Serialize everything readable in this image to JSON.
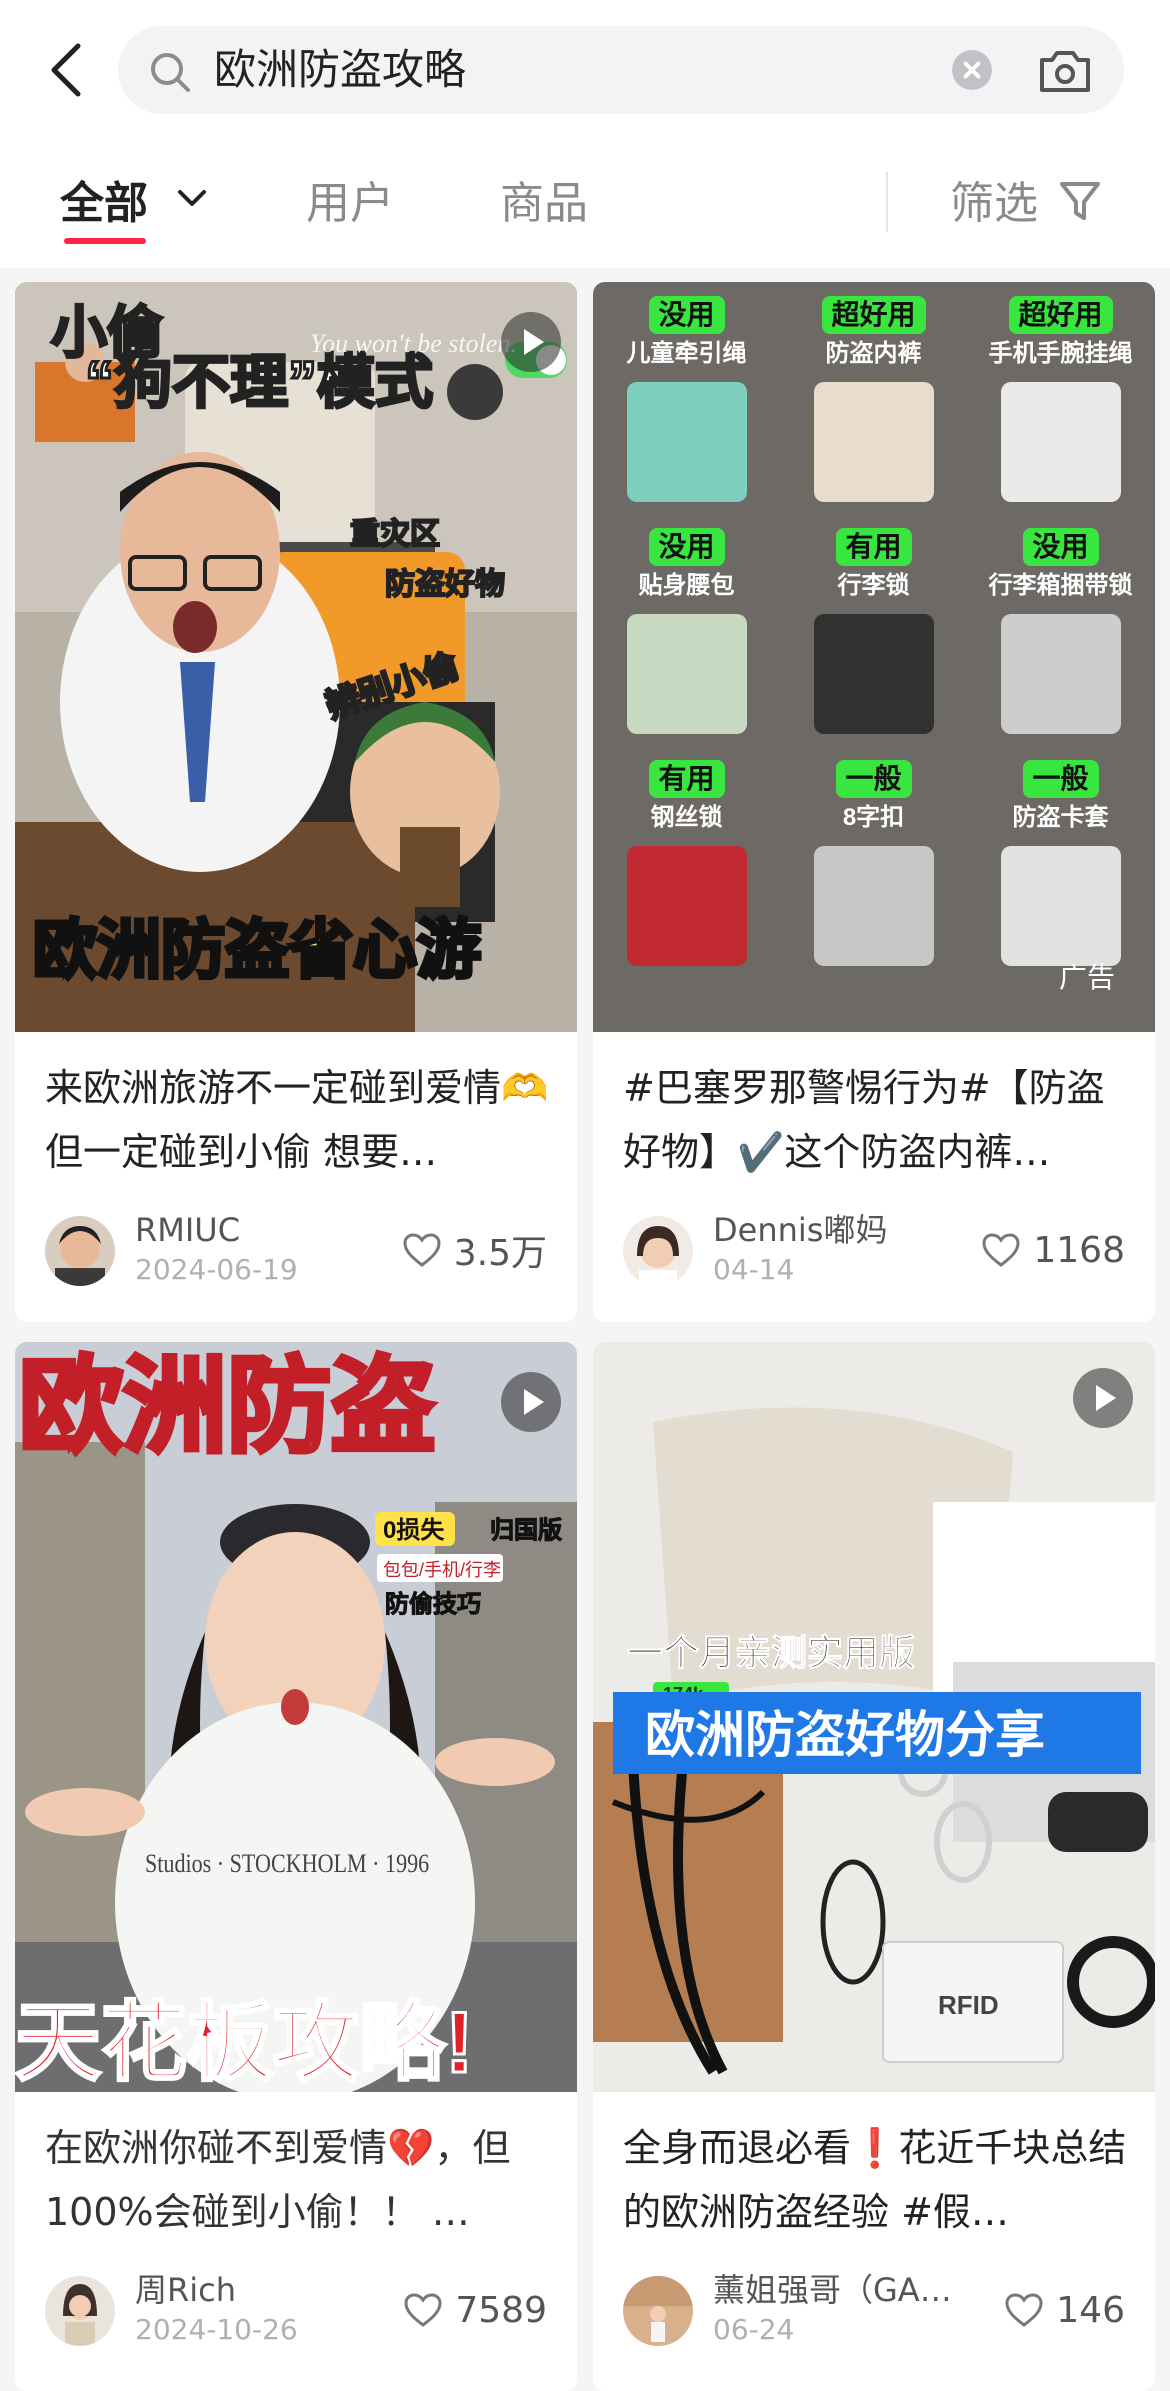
{
  "search": {
    "query": "欧洲防盗攻略"
  },
  "tabs": [
    {
      "label": "全部"
    },
    {
      "label": "用户"
    },
    {
      "label": "商品"
    }
  ],
  "filter_label": "筛选",
  "colors": {
    "accent": "#ff2442",
    "tag_green": "#39e640",
    "banner_blue": "#1e78e6",
    "title_red": "#e0212a"
  },
  "cards": [
    {
      "thumb_texts": {
        "top": "小偷",
        "line1": "“狗不理”模式",
        "watermark": "You won't be stolen.",
        "bullet1": "重灾区",
        "bullet2": "防盗好物",
        "badge": "辨别小偷",
        "banner": "欧洲防盗省心游"
      },
      "title": "来欧洲旅游不一定碰到爱情🫶但一定碰到小偷 想要…",
      "author": "RMIUC",
      "date": "2024-06-19",
      "likes": "3.5万",
      "video": true
    },
    {
      "grid": [
        {
          "tag": "没用",
          "name": "儿童牵引绳"
        },
        {
          "tag": "超好用",
          "name": "防盗内裤"
        },
        {
          "tag": "超好用",
          "name": "手机手腕挂绳"
        },
        {
          "tag": "没用",
          "name": "贴身腰包"
        },
        {
          "tag": "有用",
          "name": "行李锁"
        },
        {
          "tag": "没用",
          "name": "行李箱捆带锁"
        },
        {
          "tag": "有用",
          "name": "钢丝锁"
        },
        {
          "tag": "一般",
          "name": "8字扣"
        },
        {
          "tag": "一般",
          "name": "防盗卡套"
        }
      ],
      "ad_label": "广告",
      "title": "#巴塞罗那警惕行为#【防盗好物】✔️这个防盗内裤…",
      "author": "Dennis嘟妈",
      "date": "04-14",
      "likes": "1168",
      "video": false
    },
    {
      "thumb_texts": {
        "headline": "欧洲防盗",
        "tag1": "0损失",
        "tag2": "归国版",
        "tag3": "包包/手机/行李",
        "tag4": "防偷技巧",
        "shirt": "Studios · STOCKHOLM · 1996",
        "bottom": "天花板攻略!"
      },
      "title": "在欧洲你碰不到爱情💔，但100%会碰到小偷！！ …",
      "author": "周Rich",
      "date": "2024-10-26",
      "likes": "7589",
      "video": true
    },
    {
      "thumb_texts": {
        "subtitle": "一个月亲测实用版",
        "views": "174k",
        "banner": "欧洲防盗好物分享",
        "rfid": "RFID"
      },
      "title": "全身而退必看❗花近千块总结的欧洲防盗经验 #假…",
      "author": "薰姐强哥（GA…",
      "date": "06-24",
      "likes": "146",
      "video": true
    }
  ]
}
